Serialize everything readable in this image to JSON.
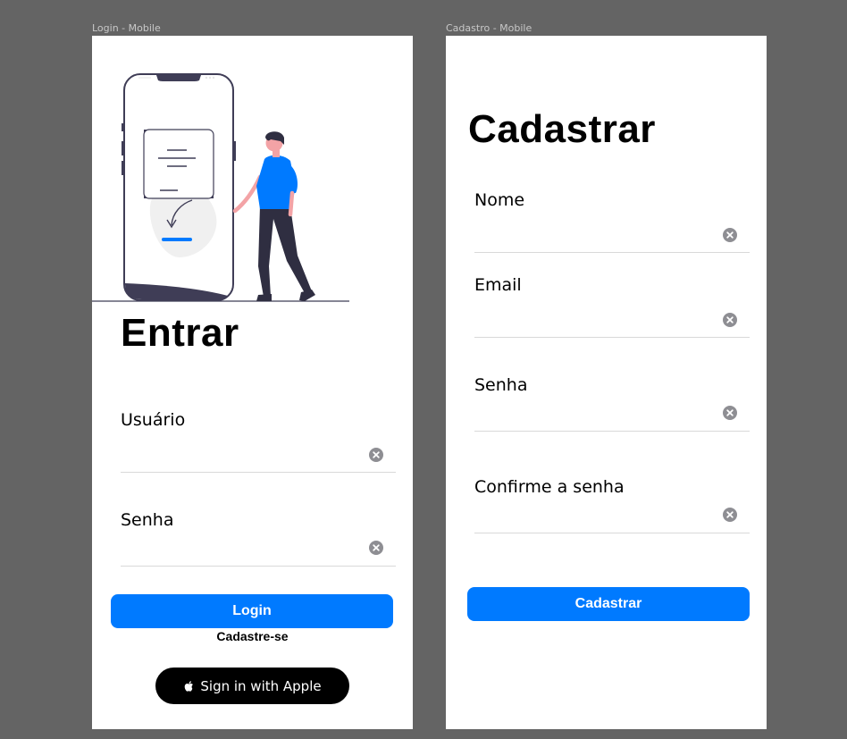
{
  "login_frame": {
    "frame_label": "Login - Mobile",
    "title": "Entrar",
    "username_label": "Usuário",
    "username_value": "",
    "password_label": "Senha",
    "password_value": "",
    "login_button": "Login",
    "signup_link": "Cadastre-se",
    "apple_button": "Sign in with Apple"
  },
  "register_frame": {
    "frame_label": "Cadastro - Mobile",
    "title": "Cadastrar",
    "name_label": "Nome",
    "name_value": "",
    "email_label": "Email",
    "email_value": "",
    "password_label": "Senha",
    "password_value": "",
    "confirm_label": "Confirme a senha",
    "confirm_value": "",
    "register_button": "Cadastrar"
  },
  "colors": {
    "canvas": "#646464",
    "primary": "#007aff",
    "clear_icon": "#8e8e93",
    "apple_button": "#000000",
    "illustration_dark": "#3f3d56",
    "illustration_accent": "#007aff",
    "illustration_skin": "#f3a3a6"
  }
}
